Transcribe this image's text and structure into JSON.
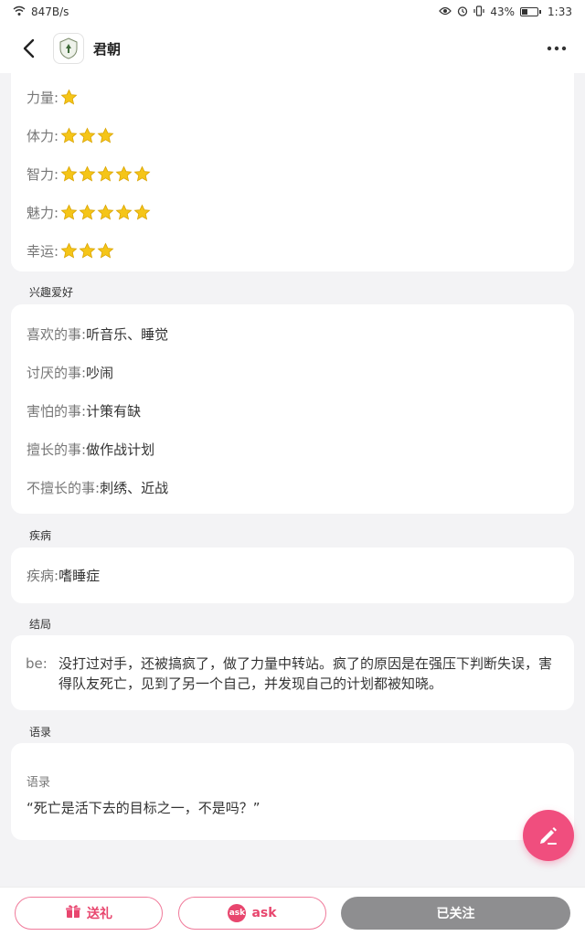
{
  "status_bar": {
    "speed": "847B/s",
    "battery": "43%",
    "time": "1:33"
  },
  "header": {
    "title": "君朝"
  },
  "attributes": [
    {
      "label": "力量:",
      "stars": 1
    },
    {
      "label": "体力:",
      "stars": 3
    },
    {
      "label": "智力:",
      "stars": 5
    },
    {
      "label": "魅力:",
      "stars": 5
    },
    {
      "label": "幸运:",
      "stars": 3
    }
  ],
  "hobbies": {
    "title": "兴趣爱好",
    "items": [
      {
        "label": "喜欢的事:",
        "value": "听音乐、睡觉"
      },
      {
        "label": "讨厌的事:",
        "value": "吵闹"
      },
      {
        "label": "害怕的事:",
        "value": "计策有缺"
      },
      {
        "label": "擅长的事:",
        "value": "做作战计划"
      },
      {
        "label": "不擅长的事:",
        "value": "刺绣、近战"
      }
    ]
  },
  "disease": {
    "title": "疾病",
    "label": "疾病:",
    "value": "嗜睡症"
  },
  "ending": {
    "title": "结局",
    "label": "be:",
    "value": "没打过对手，还被搞疯了，做了力量中转站。疯了的原因是在强压下判断失误，害得队友死亡，见到了另一个自己，并发现自己的计划都被知晓。"
  },
  "quotes": {
    "title": "语录",
    "label": "语录",
    "value": "“死亡是活下去的目标之一，不是吗？”"
  },
  "bottom": {
    "gift": "送礼",
    "ask_badge": "ask",
    "ask": "ask",
    "follow": "已关注"
  },
  "colors": {
    "accent": "#f04e7e",
    "star": "#f5c518",
    "follow_bg": "#8e8e90"
  }
}
